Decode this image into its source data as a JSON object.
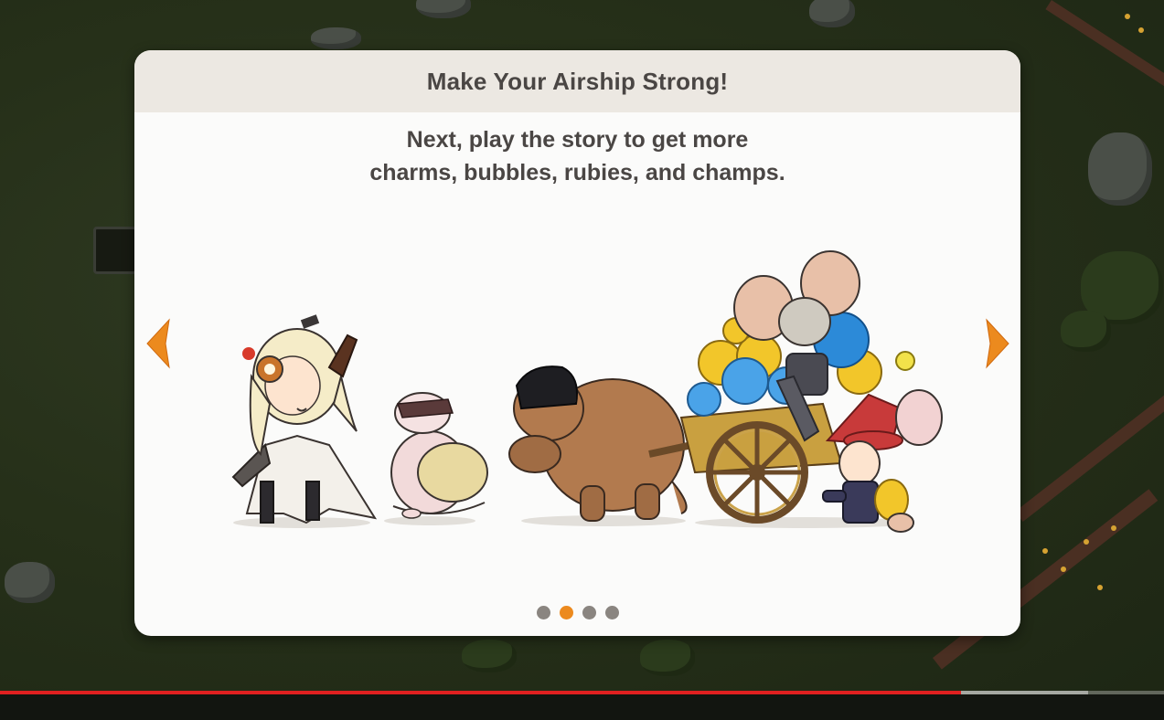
{
  "dialog": {
    "title": "Make Your Airship Strong!",
    "line1": "Next, play the story to get more",
    "line2": "charms, bubbles, rubies, and champs.",
    "page_count": 4,
    "current_page": 2
  },
  "nav": {
    "prev_icon": "chevron-left-icon",
    "next_icon": "chevron-right-icon"
  },
  "colors": {
    "accent": "#ec8a1e",
    "dot_inactive": "#8a8580",
    "header_bg": "#ece8e2",
    "text": "#4a4644",
    "progress": "#e02020"
  },
  "video": {
    "progress_fraction": 0.826,
    "buffered_fraction": 0.935
  }
}
